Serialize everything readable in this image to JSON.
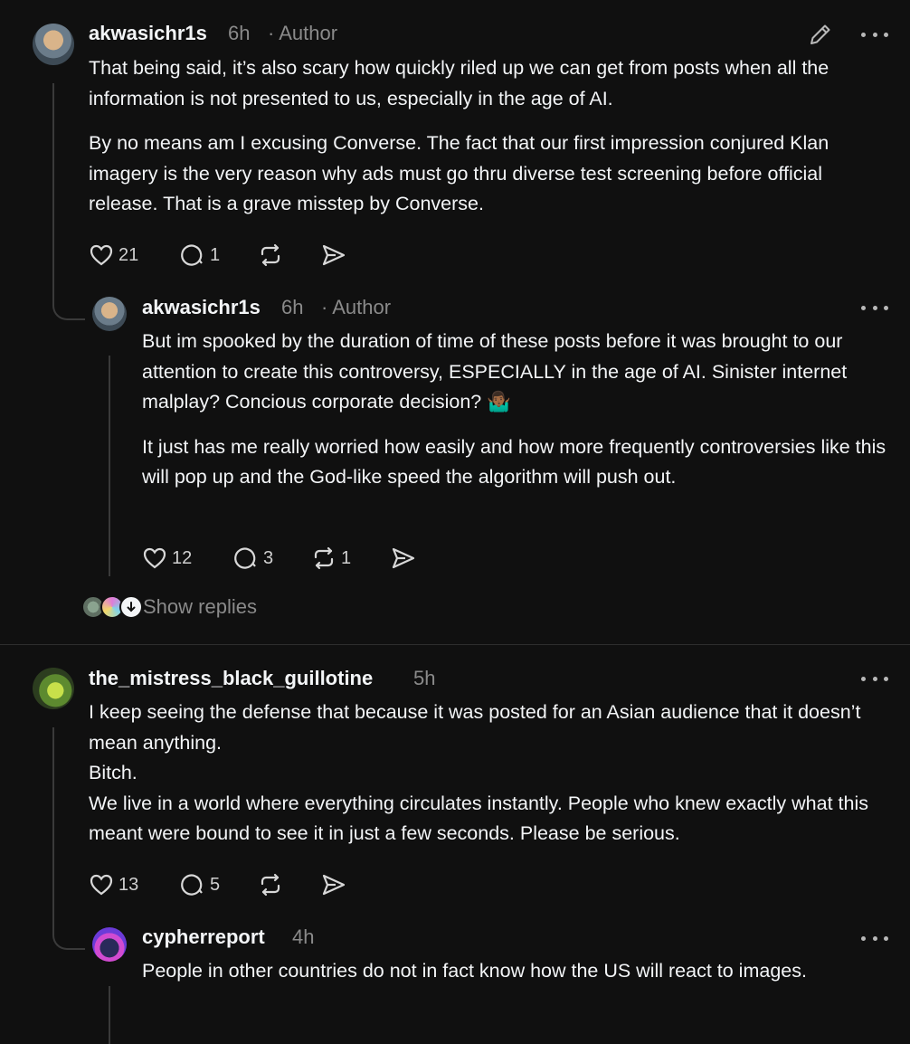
{
  "posts": [
    {
      "username": "akwasichr1s",
      "time": "6h",
      "author_badge": "· Author",
      "paragraphs": [
        "That being said, it’s also scary how quickly riled up we can get from posts when all the information is not presented to us, especially in the age of AI.",
        "By no means am I excusing Converse. The fact that our first impression conjured Klan imagery is the very reason why ads must go thru diverse test screening before official release. That is a grave misstep by Converse."
      ],
      "likes": "21",
      "replies": "1",
      "reposts": "",
      "icons": [
        "edit-pencil-icon",
        "more-icon",
        "heart-icon",
        "comment-icon",
        "repost-icon",
        "share-icon"
      ]
    },
    {
      "username": "akwasichr1s",
      "time": "6h",
      "author_badge": "· Author",
      "paragraphs": [
        "But im spooked by the duration of time of these posts before it was brought to our attention to create this controversy, ESPECIALLY in the age of AI. Sinister internet malplay? Concious corporate decision? 🤷🏾‍♂️",
        "It just has me really worried how easily and how more frequently controversies like this will pop up and the God-like speed the algorithm will push out."
      ],
      "likes": "12",
      "replies": "3",
      "reposts": "1"
    },
    {
      "username": "the_mistress_black_guillotine",
      "time": "5h",
      "paragraphs": [
        "I keep seeing the defense that because it was posted for an Asian audience that it doesn’t mean anything.",
        "Bitch.",
        "We live in a world where everything circulates instantly. People who knew exactly what this meant were bound to see it in just a few seconds. Please be serious."
      ],
      "likes": "13",
      "replies": "5",
      "reposts": ""
    },
    {
      "username": "cypherreport",
      "time": "4h",
      "paragraphs": [
        "People in other countries do not in fact know how the US will react to images."
      ]
    }
  ],
  "show_replies_label": "Show replies",
  "colors": {
    "background": "#101010",
    "text": "#f3f5f7",
    "secondary": "#8a8a8a",
    "thread_line": "#3a3a3a"
  }
}
